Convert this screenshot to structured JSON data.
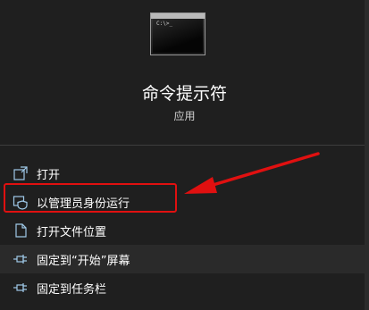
{
  "app": {
    "name": "命令提示符",
    "type": "应用",
    "icon_prompt": "C:\\>_"
  },
  "menu": {
    "items": [
      {
        "label": "打开",
        "icon": "open-icon"
      },
      {
        "label": "以管理员身份运行",
        "icon": "shield-icon"
      },
      {
        "label": "打开文件位置",
        "icon": "file-location-icon"
      },
      {
        "label": "固定到“开始”屏幕",
        "icon": "pin-icon"
      },
      {
        "label": "固定到任务栏",
        "icon": "pin-icon"
      }
    ]
  },
  "colors": {
    "background": "#1f1f1f",
    "highlight": "#e01010",
    "text": "#ffffff"
  }
}
